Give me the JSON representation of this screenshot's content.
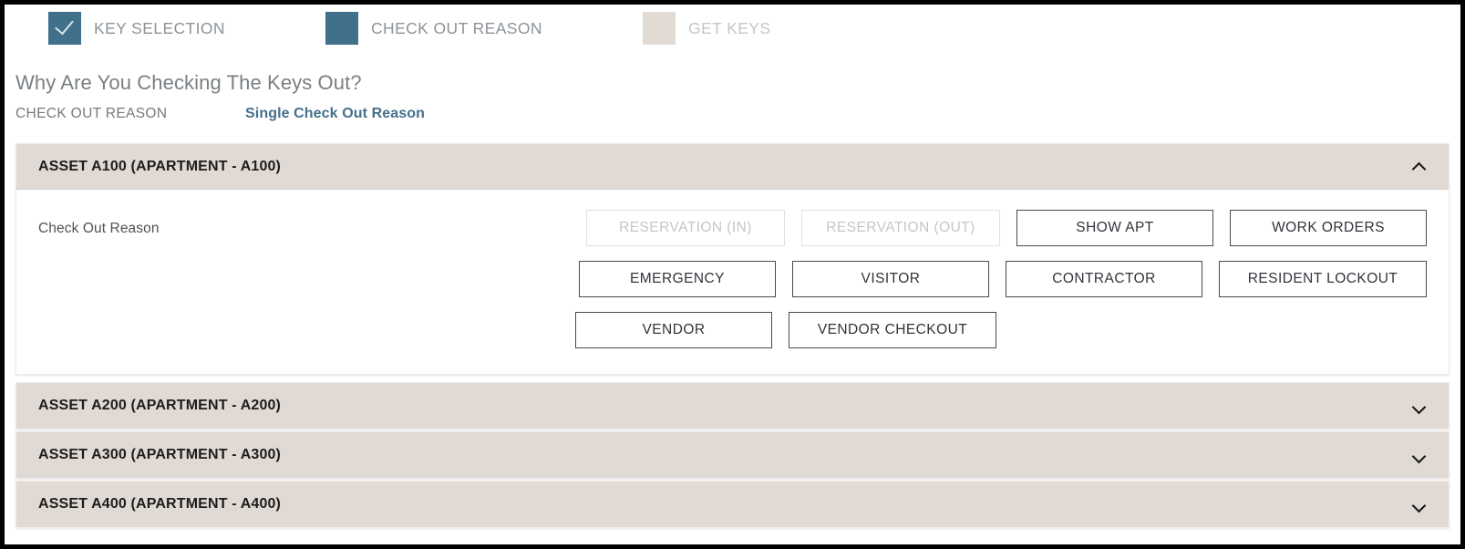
{
  "stepper": {
    "steps": [
      {
        "id": "key-selection",
        "label": "KEY SELECTION",
        "state": "done",
        "icon": "check-icon"
      },
      {
        "id": "check-out-reason",
        "label": "CHECK OUT REASON",
        "state": "active",
        "icon": "square-icon"
      },
      {
        "id": "get-keys",
        "label": "GET KEYS",
        "state": "todo",
        "icon": "square-icon"
      }
    ],
    "colors": {
      "active": "#41708a",
      "inactive": "#e2dbd4",
      "label": "#8d9398",
      "label_muted": "#c9c5c1"
    }
  },
  "header": {
    "question": "Why Are You Checking The Keys Out?",
    "section_label": "CHECK OUT REASON",
    "mode_link": "Single Check Out Reason",
    "link_color": "#456f8b"
  },
  "accordion": {
    "header_bg": "#e1dad4",
    "panels": [
      {
        "title": "ASSET A100 (APARTMENT - A100)",
        "expanded": true,
        "chevron": "chevron-up-icon",
        "field_label": "Check Out Reason",
        "choice_rows": [
          [
            {
              "label": "RESERVATION (IN)",
              "disabled": true,
              "width_class": "w-res"
            },
            {
              "label": "RESERVATION (OUT)",
              "disabled": true,
              "width_class": "w-res"
            },
            {
              "label": "SHOW APT",
              "disabled": false,
              "width_class": "w-show"
            },
            {
              "label": "WORK ORDERS",
              "disabled": false,
              "width_class": "w-work"
            }
          ],
          [
            {
              "label": "EMERGENCY",
              "disabled": false,
              "width_class": "w-emer"
            },
            {
              "label": "VISITOR",
              "disabled": false,
              "width_class": "w-vis"
            },
            {
              "label": "CONTRACTOR",
              "disabled": false,
              "width_class": "w-con"
            },
            {
              "label": "RESIDENT LOCKOUT",
              "disabled": false,
              "width_class": "w-lock"
            }
          ],
          [
            {
              "label": "VENDOR",
              "disabled": false,
              "width_class": "w-vend"
            },
            {
              "label": "VENDOR CHECKOUT",
              "disabled": false,
              "width_class": "w-vendc"
            }
          ]
        ]
      },
      {
        "title": "ASSET A200 (APARTMENT - A200)",
        "expanded": false,
        "chevron": "chevron-down-icon"
      },
      {
        "title": "ASSET A300 (APARTMENT - A300)",
        "expanded": false,
        "chevron": "chevron-down-icon"
      },
      {
        "title": "ASSET A400 (APARTMENT - A400)",
        "expanded": false,
        "chevron": "chevron-down-icon"
      }
    ]
  }
}
